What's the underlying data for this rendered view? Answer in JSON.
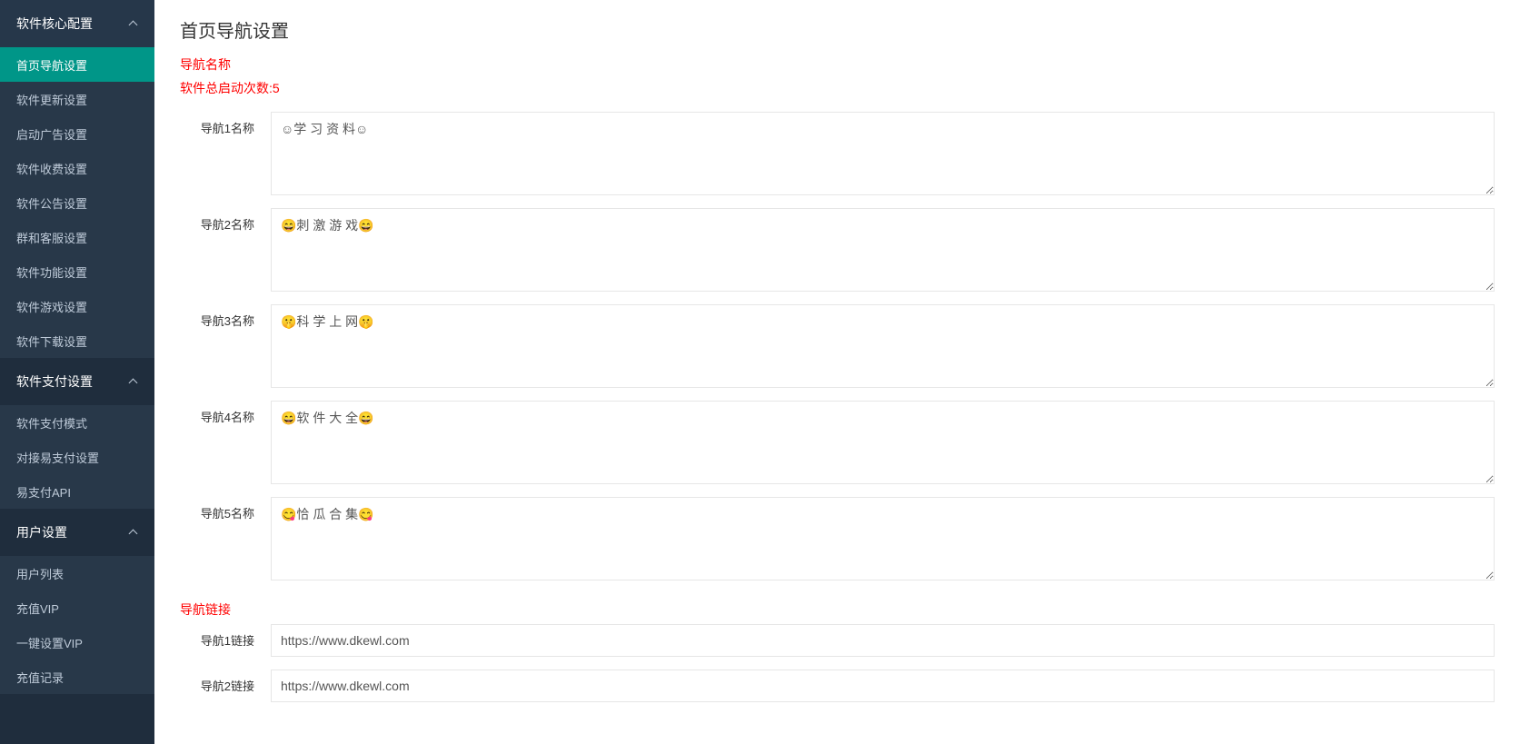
{
  "sidebar": {
    "sections": [
      {
        "title": "软件核心配置",
        "items": [
          {
            "label": "首页导航设置",
            "active": true
          },
          {
            "label": "软件更新设置",
            "active": false
          },
          {
            "label": "启动广告设置",
            "active": false
          },
          {
            "label": "软件收费设置",
            "active": false
          },
          {
            "label": "软件公告设置",
            "active": false
          },
          {
            "label": "群和客服设置",
            "active": false
          },
          {
            "label": "软件功能设置",
            "active": false
          },
          {
            "label": "软件游戏设置",
            "active": false
          },
          {
            "label": "软件下载设置",
            "active": false
          }
        ]
      },
      {
        "title": "软件支付设置",
        "items": [
          {
            "label": "软件支付模式",
            "active": false
          },
          {
            "label": "对接易支付设置",
            "active": false
          },
          {
            "label": "易支付API",
            "active": false
          }
        ]
      },
      {
        "title": "用户设置",
        "items": [
          {
            "label": "用户列表",
            "active": false
          },
          {
            "label": "充值VIP",
            "active": false
          },
          {
            "label": "一键设置VIP",
            "active": false
          },
          {
            "label": "充值记录",
            "active": false
          }
        ]
      }
    ]
  },
  "main": {
    "page_title": "首页导航设置",
    "nav_name_label": "导航名称",
    "startup_count_text": "软件总启动次数:5",
    "nav_link_label": "导航链接",
    "fields": {
      "nav1_name_label": "导航1名称",
      "nav1_name_value": "☺学 习 资 料☺",
      "nav2_name_label": "导航2名称",
      "nav2_name_value": "😄刺 激 游 戏😄",
      "nav3_name_label": "导航3名称",
      "nav3_name_value": "🤫科 学 上 网🤫",
      "nav4_name_label": "导航4名称",
      "nav4_name_value": "😄软 件 大 全😄",
      "nav5_name_label": "导航5名称",
      "nav5_name_value": "😋恰 瓜 合 集😋",
      "nav1_link_label": "导航1链接",
      "nav1_link_value": "https://www.dkewl.com",
      "nav2_link_label": "导航2链接",
      "nav2_link_value": "https://www.dkewl.com"
    }
  }
}
